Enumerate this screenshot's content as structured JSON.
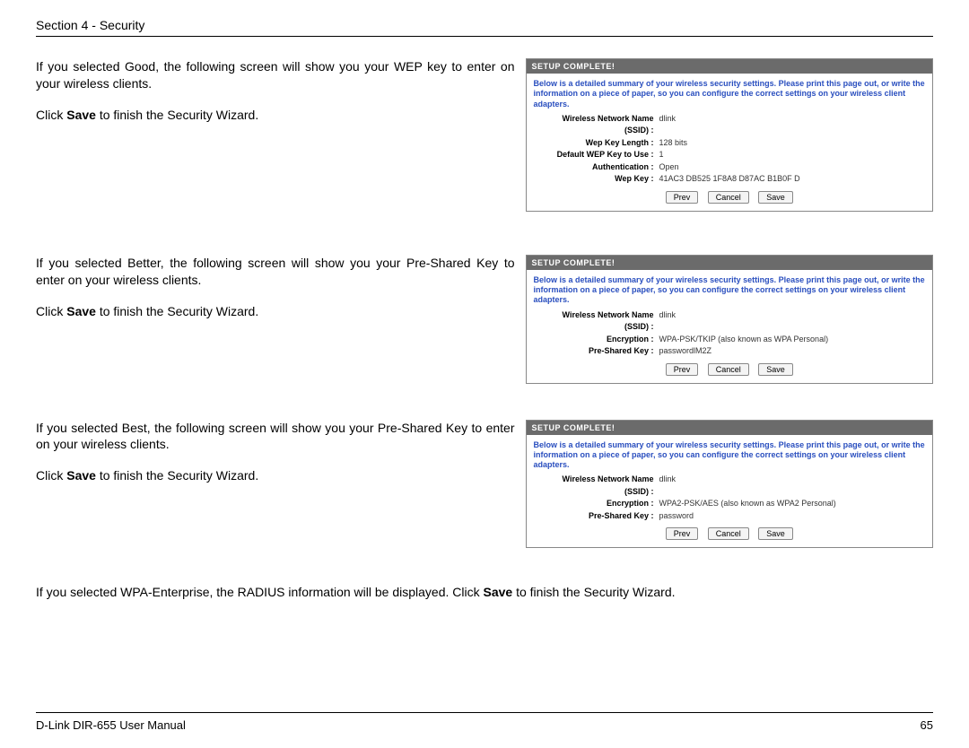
{
  "header": "Section 4 - Security",
  "good": {
    "p1": "If you selected Good, the following screen will show you your WEP key to enter on your wireless clients.",
    "p2a": "Click ",
    "p2b": "Save",
    "p2c": " to finish the Security Wizard."
  },
  "better": {
    "p1": "If you selected Better, the following screen will show you your Pre-Shared Key to enter on your wireless clients.",
    "p2a": "Click ",
    "p2b": "Save",
    "p2c": " to finish the Security Wizard."
  },
  "best": {
    "p1": "If you selected Best, the following screen will show you your Pre-Shared Key to enter on your wireless clients.",
    "p2a": "Click ",
    "p2b": "Save",
    "p2c": " to finish the Security Wizard."
  },
  "enterprise": {
    "a": "If you selected WPA-Enterprise, the RADIUS information will be displayed. Click ",
    "b": "Save",
    "c": " to finish the Security Wizard."
  },
  "panel_shared": {
    "title": "SETUP COMPLETE!",
    "msg": "Below is a detailed summary of your wireless security settings. Please print this page out, or write the information on a piece of paper, so you can configure the correct settings on your wireless client adapters.",
    "ssid_label_line1": "Wireless Network Name",
    "ssid_label_line2": "(SSID) :",
    "btn_prev": "Prev",
    "btn_cancel": "Cancel",
    "btn_save": "Save"
  },
  "panel_good": {
    "ssid": "dlink",
    "wep_len_label": "Wep Key Length :",
    "wep_len": "128 bits",
    "def_key_label": "Default WEP Key to Use :",
    "def_key": "1",
    "auth_label": "Authentication :",
    "auth": "Open",
    "wk_label": "Wep Key :",
    "wk": "41AC3 DB525 1F8A8 D87AC B1B0F D"
  },
  "panel_better": {
    "ssid": "dlink",
    "enc_label": "Encryption :",
    "enc": "WPA-PSK/TKIP (also known as WPA Personal)",
    "psk_label": "Pre-Shared Key :",
    "psk": "passwordlM2Z"
  },
  "panel_best": {
    "ssid": "dlink",
    "enc_label": "Encryption :",
    "enc": "WPA2-PSK/AES (also known as WPA2 Personal)",
    "psk_label": "Pre-Shared Key :",
    "psk": "password"
  },
  "footer": {
    "left": "D-Link DIR-655 User Manual",
    "right": "65"
  }
}
